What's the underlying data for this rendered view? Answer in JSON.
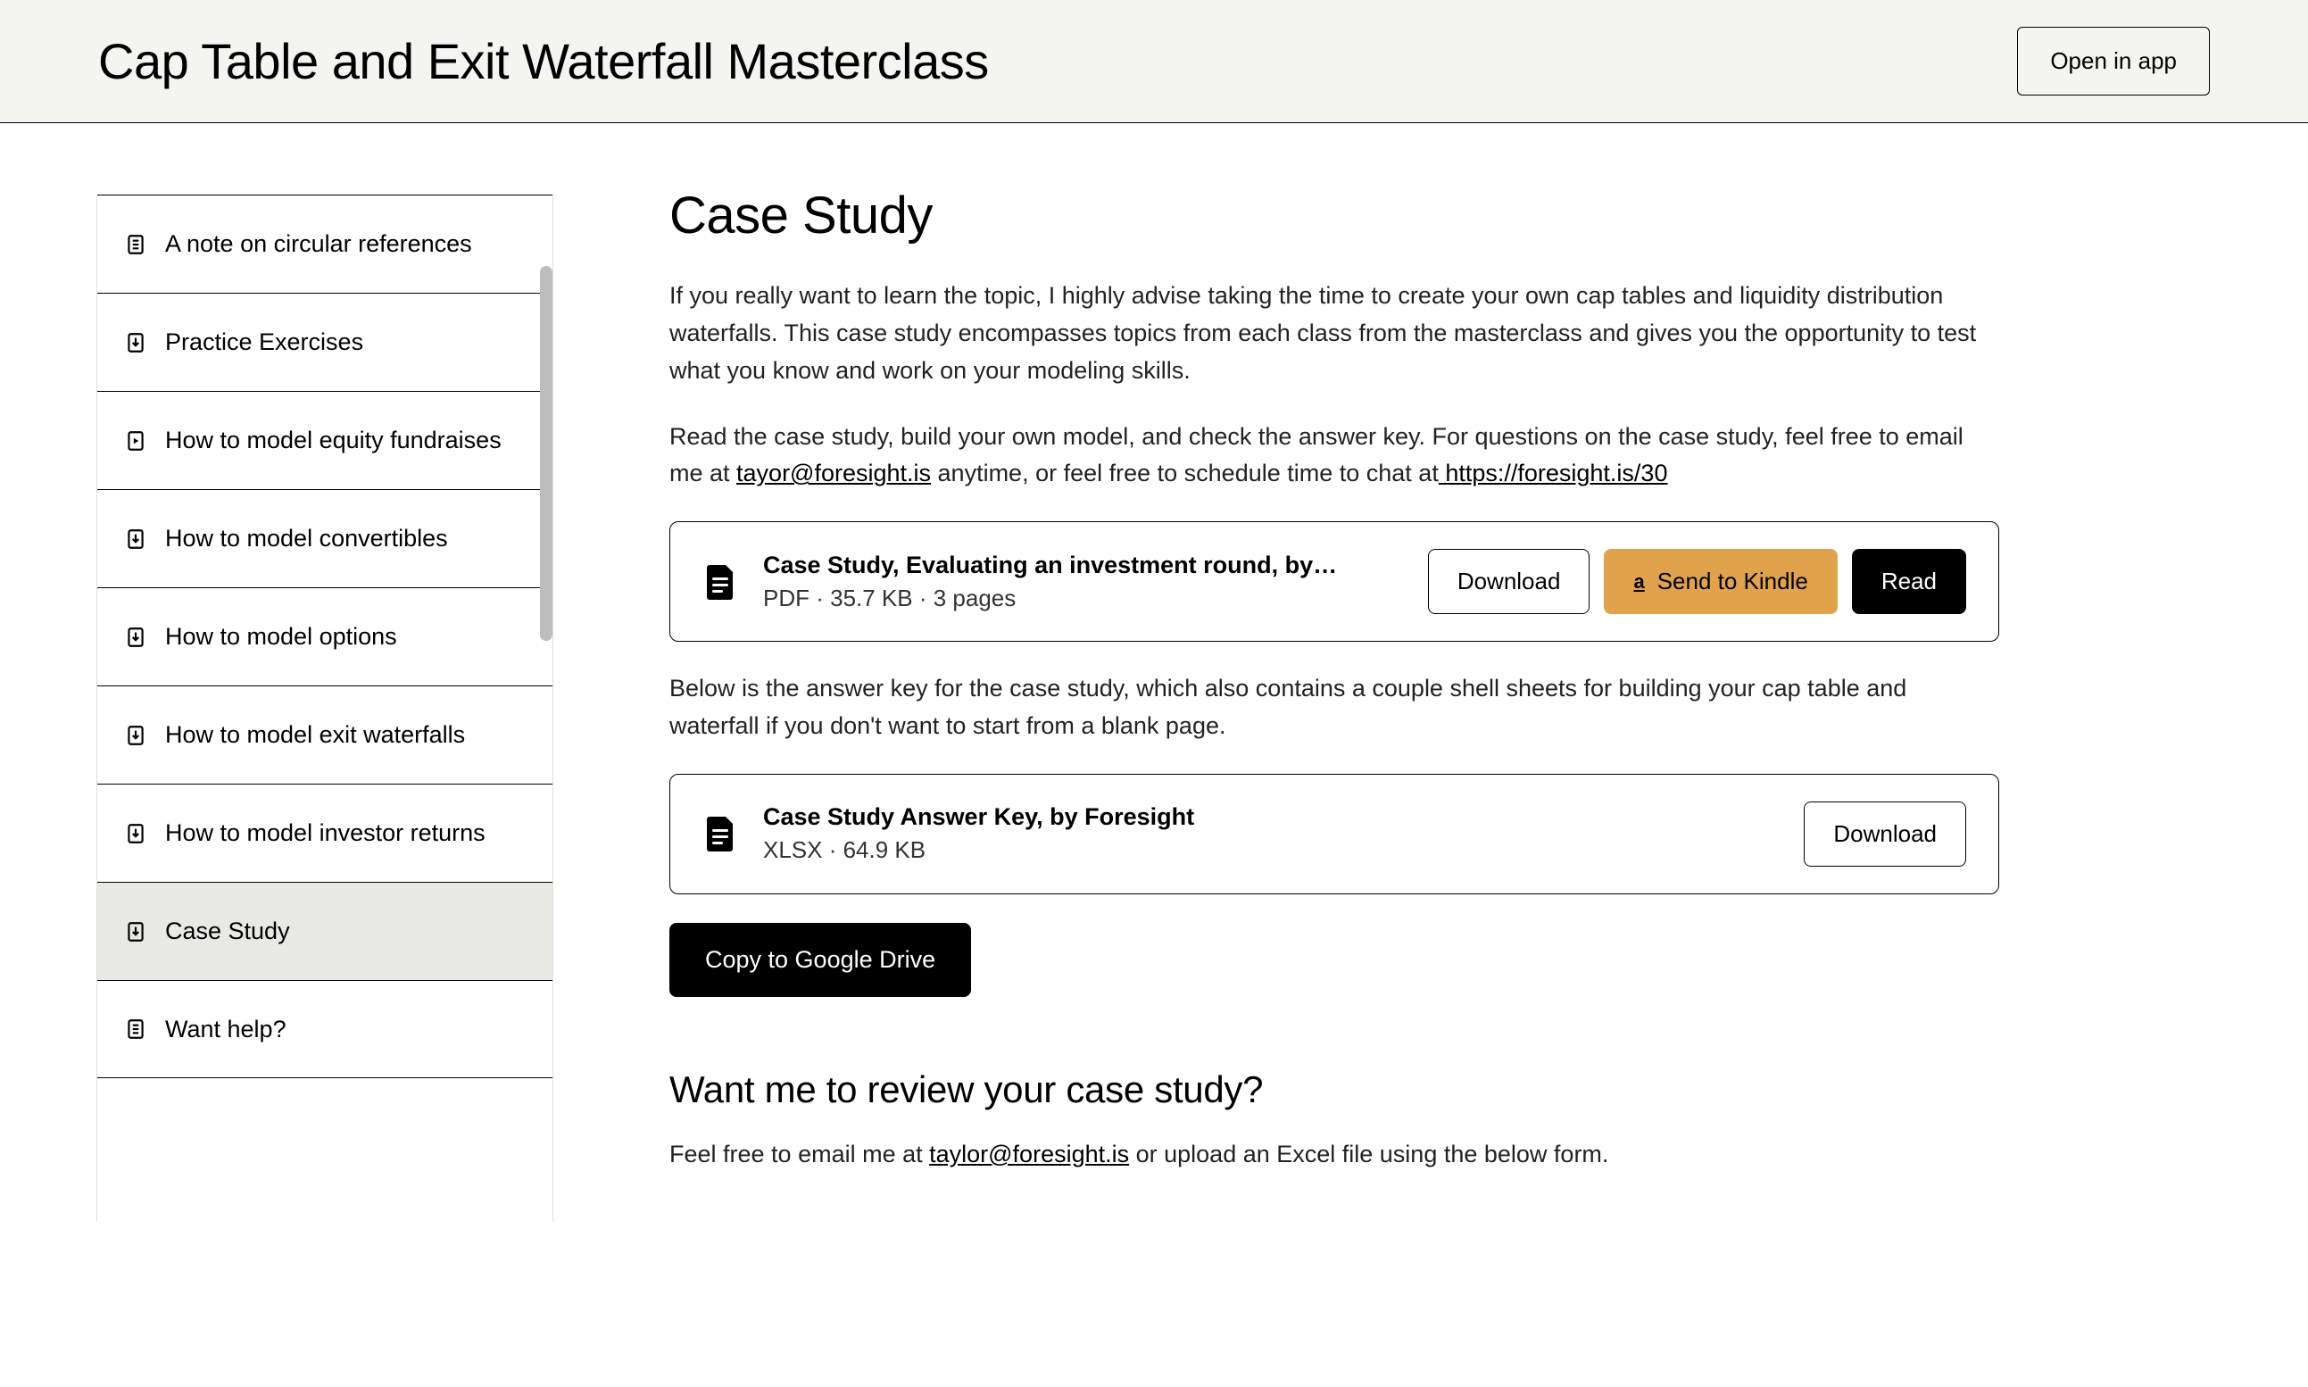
{
  "header": {
    "title": "Cap Table and Exit Waterfall Masterclass",
    "open_in_app": "Open in app"
  },
  "sidebar": {
    "items": [
      {
        "icon": "doc",
        "label": "A note on circular references"
      },
      {
        "icon": "download",
        "label": "Practice Exercises"
      },
      {
        "icon": "play",
        "label": "How to model equity fundraises"
      },
      {
        "icon": "download",
        "label": "How to model convertibles"
      },
      {
        "icon": "download",
        "label": "How to model options"
      },
      {
        "icon": "download",
        "label": "How to model exit waterfalls"
      },
      {
        "icon": "download",
        "label": "How to model investor returns"
      },
      {
        "icon": "download",
        "label": "Case Study",
        "active": true
      },
      {
        "icon": "doc",
        "label": "Want help?"
      }
    ]
  },
  "main": {
    "title": "Case Study",
    "intro": "If you really want to learn the topic, I highly advise taking the time to create your own cap tables and liquidity distribution waterfalls. This case study encompasses topics from each class from the masterclass and gives you the opportunity to test what you know and work on your modeling skills.",
    "read_prefix": "Read the case study, build your own model, and check the answer key. For questions on the case study, feel free to email me at ",
    "email1": "tayor@foresight.is",
    "read_mid": " anytime, or feel free to schedule time to chat at",
    "schedule_link": " https://foresight.is/30",
    "file1": {
      "title": "Case Study, Evaluating an investment round, by…",
      "meta": "PDF · 35.7 KB · 3 pages",
      "download": "Download",
      "kindle": "Send to Kindle",
      "read": "Read"
    },
    "answer_intro": "Below is the answer key for the case study, which also contains a couple shell sheets for building your cap table and waterfall if you don't want to start from a blank page.",
    "file2": {
      "title": "Case Study Answer Key, by Foresight",
      "meta": "XLSX · 64.9 KB",
      "download": "Download"
    },
    "copy_drive": "Copy to Google Drive",
    "review_heading": "Want me to review your case study?",
    "review_prefix": "Feel free to email me at ",
    "email2": "taylor@foresight.is",
    "review_suffix": " or upload an Excel file using the below form."
  }
}
